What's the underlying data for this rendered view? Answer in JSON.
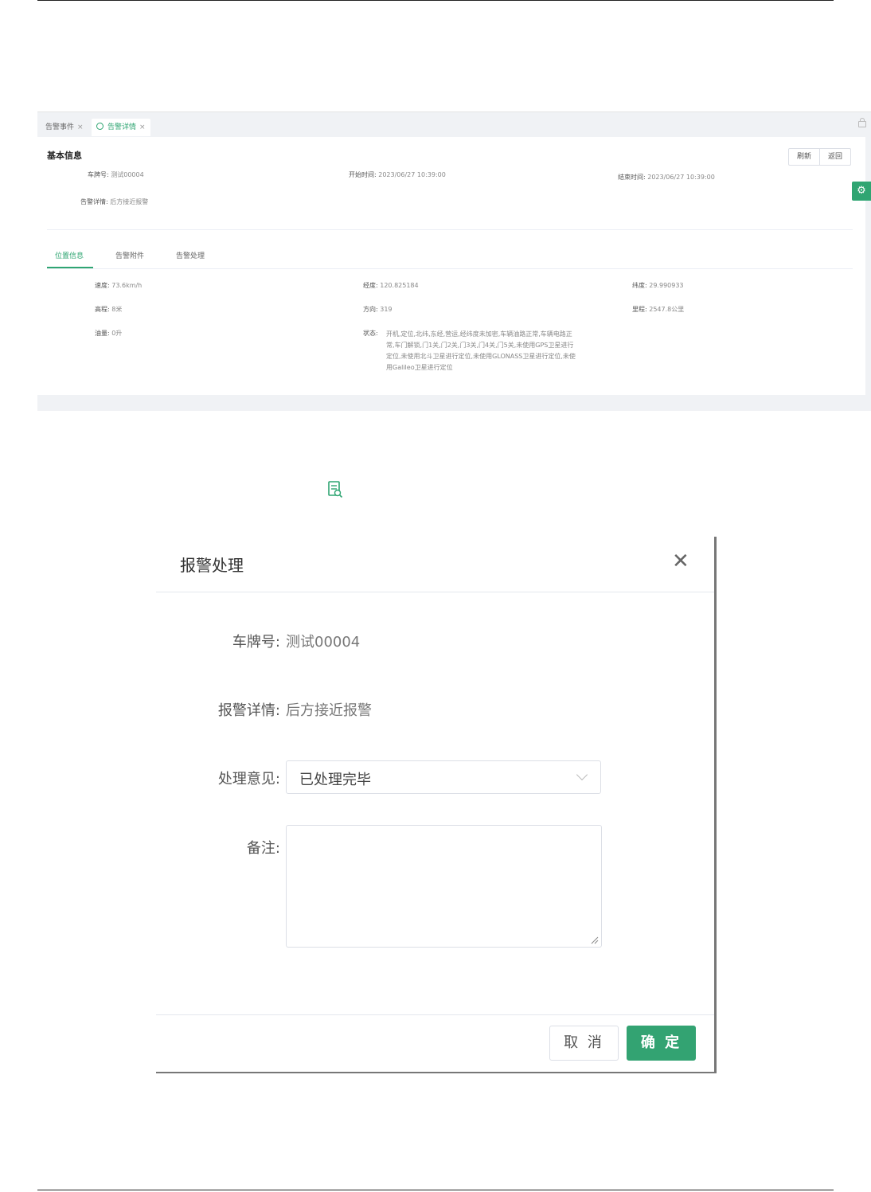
{
  "tabs": [
    {
      "label": "告警事件"
    },
    {
      "label": "告警详情"
    }
  ],
  "basic_info": {
    "title": "基本信息",
    "plate_label": "车牌号:",
    "plate_value": "测试00004",
    "start_label": "开始时间:",
    "start_value": "2023/06/27 10:39:00",
    "end_label": "结束时间:",
    "end_value": "2023/06/27 10:39:00",
    "detail_label": "告警详情:",
    "detail_value": "后方接近报警",
    "refresh_label": "刷新",
    "back_label": "返回"
  },
  "sub_tabs": [
    "位置信息",
    "告警附件",
    "告警处理"
  ],
  "location": {
    "speed_label": "速度:",
    "speed_value": "73.6km/h",
    "lng_label": "经度:",
    "lng_value": "120.825184",
    "lat_label": "纬度:",
    "lat_value": "29.990933",
    "alt_label": "高程:",
    "alt_value": "8米",
    "dir_label": "方向:",
    "dir_value": "319",
    "mileage_label": "里程:",
    "mileage_value": "2547.8公里",
    "fuel_label": "油量:",
    "fuel_value": "0升",
    "status_label": "状态:",
    "status_value": "开机,定位,北纬,东经,营运,经纬度未加密,车辆油路正常,车辆电路正常,车门解锁,门1关,门2关,门3关,门4关,门5关,未使用GPS卫星进行定位,未使用北斗卫星进行定位,未使用GLONASS卫星进行定位,未使用Galileo卫星进行定位"
  },
  "dialog": {
    "title": "报警处理",
    "plate_label": "车牌号:",
    "plate_value": "测试00004",
    "detail_label": "报警详情:",
    "detail_value": "后方接近报警",
    "opinion_label": "处理意见:",
    "opinion_value": "已处理完毕",
    "remark_label": "备注:",
    "remark_value": "",
    "cancel_label": "取 消",
    "ok_label": "确 定"
  },
  "colors": {
    "accent": "#33a372",
    "text": "#333333",
    "muted": "#888888"
  },
  "icons": [
    "close-icon",
    "gear-icon",
    "lock-icon",
    "document-icon",
    "chevron-down-icon",
    "loading-icon"
  ]
}
